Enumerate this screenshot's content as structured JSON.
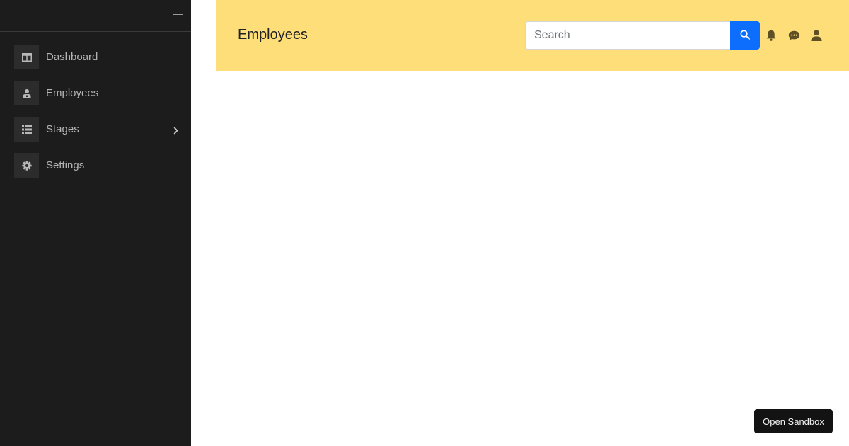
{
  "sidebar": {
    "toggle_icon": "hamburger-icon",
    "items": [
      {
        "label": "Dashboard",
        "icon": "layout-icon"
      },
      {
        "label": "Employees",
        "icon": "person-badge-icon"
      },
      {
        "label": "Stages",
        "icon": "list-icon",
        "has_submenu": true
      },
      {
        "label": "Settings",
        "icon": "gear-icon"
      }
    ]
  },
  "header": {
    "title": "Employees",
    "search": {
      "placeholder": "Search",
      "value": ""
    },
    "icons": [
      "search-icon",
      "bell-icon",
      "chat-icon",
      "user-icon"
    ]
  },
  "footer": {
    "sandbox_label": "Open Sandbox"
  },
  "colors": {
    "sidebar_bg": "#1c1c1c",
    "header_bg": "#fdde78",
    "accent": "#0d6efd",
    "header_icon": "#5e4f24"
  }
}
